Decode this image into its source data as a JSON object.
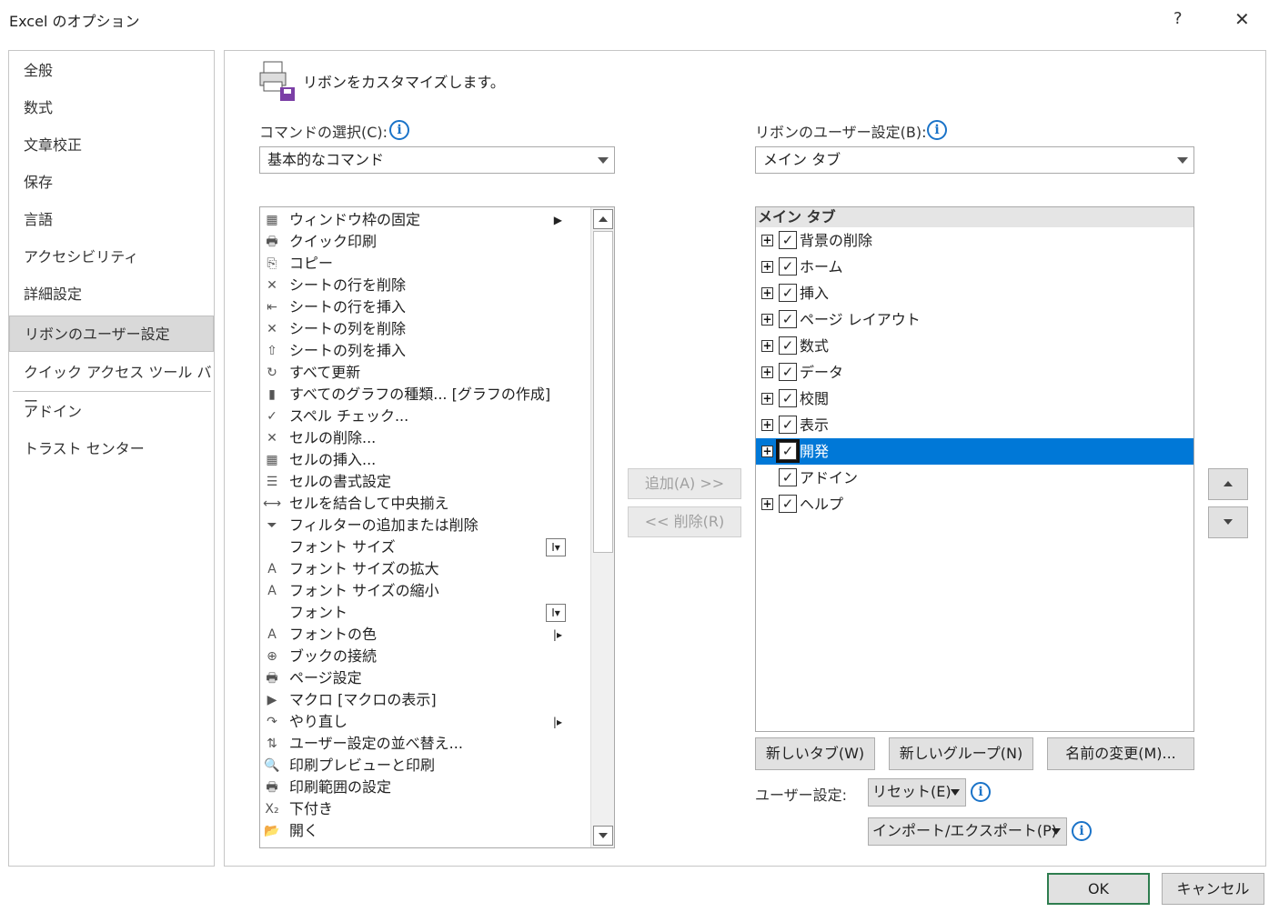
{
  "window": {
    "title": "Excel のオプション",
    "help": "?",
    "close": "✕"
  },
  "nav": {
    "items": [
      "全般",
      "数式",
      "文章校正",
      "保存",
      "言語",
      "アクセシビリティ",
      "詳細設定",
      "リボンのユーザー設定",
      "クイック アクセス ツール バー",
      "アドイン",
      "トラスト センター"
    ]
  },
  "main": {
    "heading": "リボンをカスタマイズします。",
    "choose_label": "コマンドの選択(C):",
    "choose_value": "基本的なコマンド",
    "customize_label": "リボンのユーザー設定(B):",
    "customize_value": "メイン タブ",
    "add_button": "追加(A) >>",
    "remove_button": "<< 削除(R)",
    "info": "i"
  },
  "commands": [
    {
      "label": "ウィンドウ枠の固定",
      "icon": "▦"
    },
    {
      "label": "クイック印刷",
      "icon": "🖶"
    },
    {
      "label": "コピー",
      "icon": "⎘"
    },
    {
      "label": "シートの行を削除",
      "icon": "✕"
    },
    {
      "label": "シートの行を挿入",
      "icon": "⇤"
    },
    {
      "label": "シートの列を削除",
      "icon": "✕"
    },
    {
      "label": "シートの列を挿入",
      "icon": "⇧"
    },
    {
      "label": "すべて更新",
      "icon": "↻"
    },
    {
      "label": "すべてのグラフの種類... [グラフの作成]",
      "icon": "▮"
    },
    {
      "label": "スペル チェック...",
      "icon": "✓"
    },
    {
      "label": "セルの削除...",
      "icon": "✕"
    },
    {
      "label": "セルの挿入...",
      "icon": "▦"
    },
    {
      "label": "セルの書式設定",
      "icon": "☰"
    },
    {
      "label": "セルを結合して中央揃え",
      "icon": "⟷"
    },
    {
      "label": "フィルターの追加または削除",
      "icon": "⏷"
    },
    {
      "label": "フォント サイズ",
      "icon": ""
    },
    {
      "label": "フォント サイズの拡大",
      "icon": "A"
    },
    {
      "label": "フォント サイズの縮小",
      "icon": "A"
    },
    {
      "label": "フォント",
      "icon": ""
    },
    {
      "label": "フォントの色",
      "icon": "A"
    },
    {
      "label": "ブックの接続",
      "icon": "⊕"
    },
    {
      "label": "ページ設定",
      "icon": "🖶"
    },
    {
      "label": "マクロ [マクロの表示]",
      "icon": "▶"
    },
    {
      "label": "やり直し",
      "icon": "↷"
    },
    {
      "label": "ユーザー設定の並べ替え...",
      "icon": "⇅"
    },
    {
      "label": "印刷プレビューと印刷",
      "icon": "🔍"
    },
    {
      "label": "印刷範囲の設定",
      "icon": "🖶"
    },
    {
      "label": "下付き",
      "icon": "X₂"
    },
    {
      "label": "開く",
      "icon": "📂"
    }
  ],
  "tree": {
    "header": "メイン タブ",
    "items": [
      {
        "label": "背景の削除",
        "expand": true
      },
      {
        "label": "ホーム",
        "expand": true
      },
      {
        "label": "挿入",
        "expand": true
      },
      {
        "label": "ページ レイアウト",
        "expand": true
      },
      {
        "label": "数式",
        "expand": true
      },
      {
        "label": "データ",
        "expand": true
      },
      {
        "label": "校閲",
        "expand": true
      },
      {
        "label": "表示",
        "expand": true
      },
      {
        "label": "開発",
        "expand": true
      },
      {
        "label": "アドイン",
        "expand": false
      },
      {
        "label": "ヘルプ",
        "expand": true
      }
    ]
  },
  "tree_buttons": {
    "new_tab": "新しいタブ(W)",
    "new_group": "新しいグループ(N)",
    "rename": "名前の変更(M)..."
  },
  "user_settings": {
    "label": "ユーザー設定:",
    "reset": "リセット(E)",
    "import_export": "インポート/エクスポート(P)"
  },
  "footer": {
    "ok": "OK",
    "cancel": "キャンセル"
  },
  "colors": {
    "selection": "#0078d7",
    "info": "#1a73c8",
    "ok_border": "#2e7d4f"
  }
}
